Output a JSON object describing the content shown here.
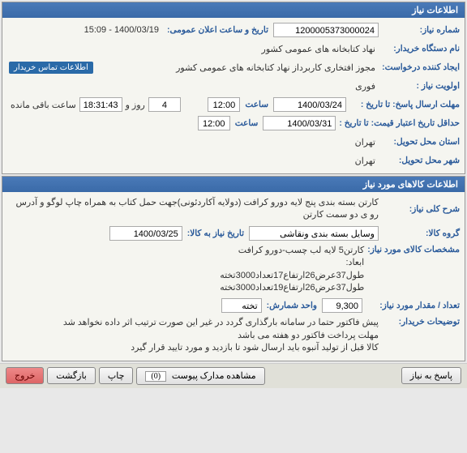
{
  "panel1": {
    "title": "اطلاعات نیاز",
    "need_number_label": "شماره نیاز:",
    "need_number": "1200005373000024",
    "announce_label": "تاریخ و ساعت اعلان عمومی:",
    "announce_value": "1400/03/19 - 15:09",
    "buyer_agency_label": "نام دستگاه خریدار:",
    "buyer_agency": "نهاد کتابخانه های عمومی کشور",
    "requester_label": "ایجاد کننده درخواست:",
    "requester": "مجوز افتخاری کاربرداز نهاد کتابخانه های عمومی کشور",
    "contact_button": "اطلاعات تماس خریدار",
    "priority_label": "اولویت نیاز :",
    "priority": "فوری",
    "deadline_response_label": "مهلت ارسال پاسخ:",
    "until_date_label": "تا تاریخ :",
    "deadline_date": "1400/03/24",
    "hour_label": "ساعت",
    "deadline_hour": "12:00",
    "days_remaining": "4",
    "days_label": "روز و",
    "time_remaining": "18:31:43",
    "remain_label": "ساعت باقی مانده",
    "min_validity_label": "حداقل تاریخ اعتبار قیمت:",
    "validity_date": "1400/03/31",
    "validity_hour": "12:00",
    "delivery_province_label": "استان محل تحویل:",
    "delivery_province": "تهران",
    "delivery_city_label": "شهر محل تحویل:",
    "delivery_city": "تهران"
  },
  "panel2": {
    "title": "اطلاعات کالاهای مورد نیاز",
    "desc_label": "شرح کلی نیاز:",
    "desc": "کارتن بسته بندی پنج لایه دورو کرافت (دولایه آکاردئونی)جهت حمل کتاب به همراه چاپ لوگو و آدرس رو ی دو سمت کارتن",
    "group_label": "گروه کالا:",
    "group": "وسایل بسته بندی  ونقاشی",
    "need_date_label": "تاریخ نیاز به کالا:",
    "need_date": "1400/03/25",
    "spec_label": "مشخصات کالای مورد نیاز:",
    "spec": "کارتن5 لایه لب چسب-دورو کرافت\nابعاد:\nطول37عرض26ارتفاع17تعداد3000تخته\nطول37عرض26ارتفاع19تعداد3000تخته",
    "qty_label": "تعداد / مقدار مورد نیاز:",
    "qty": "9,300",
    "unit_label": "واحد شمارش:",
    "unit": "تخته",
    "notes_label": "توضیحات خریدار:",
    "notes": "پیش فاکتور حتما در سامانه بارگذاری گردد در غیر این صورت ترتیب اثر داده نخواهد شد\nمهلت پرداخت فاکتور دو هفته می باشد\nکالا قبل از تولید آنبوه باید ارسال شود تا بازدید و مورد تایید قرار گیرد"
  },
  "bottom": {
    "respond": "پاسخ به نیاز",
    "view_docs": "مشاهده مدارک پیوست",
    "doc_count": "(0)",
    "print": "چاپ",
    "back": "بازگشت",
    "exit": "خروج"
  }
}
